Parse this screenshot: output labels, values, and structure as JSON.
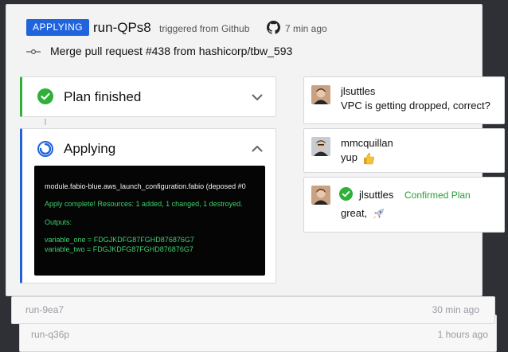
{
  "run": {
    "status_badge": "APPLYING",
    "id": "run-QPs8",
    "trigger": "triggered from Github",
    "time": "7 min ago",
    "commit": "Merge pull request #438 from hashicorp/tbw_593"
  },
  "steps": {
    "plan": {
      "title": "Plan finished"
    },
    "apply": {
      "title": "Applying"
    }
  },
  "terminal": {
    "line1": "module.fabio-blue.aws_launch_configuration.fabio (deposed #0",
    "line2": "Apply complete! Resources: 1 added, 1 changed, 1 destroyed.",
    "line3": "Outputs:",
    "line4": "variable_one = FDGJKDFG87FGHD876876G7",
    "line5": "variable_two = FDGJKDFG87FGHD876876G7"
  },
  "comments": [
    {
      "user": "jlsuttles",
      "text": "VPC is getting dropped, correct?"
    },
    {
      "user": "mmcquillan",
      "text": "yup"
    },
    {
      "user": "jlsuttles",
      "action": "Confirmed Plan",
      "text": "great,"
    }
  ],
  "previous_runs": [
    {
      "id": "run-9ea7",
      "time": "30 min ago"
    },
    {
      "id": "run-q36p",
      "time": "1 hours ago"
    }
  ],
  "colors": {
    "accent_blue": "#1f63dd",
    "success_green": "#2eb039",
    "terminal_green": "#3ed26b",
    "background": "#2f3035"
  },
  "icons": {
    "commit": "git-commit-icon",
    "github": "github-icon",
    "plan_status": "check-circle-icon",
    "apply_status": "spinner-icon",
    "thumbs_up": "thumbs-up-emoji",
    "rocket": "rocket-emoji"
  }
}
